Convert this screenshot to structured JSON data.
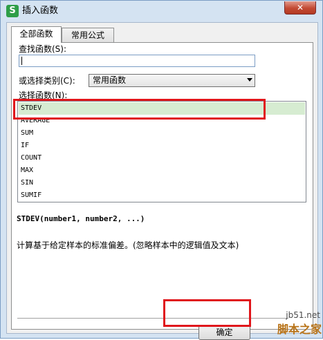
{
  "window": {
    "title": "插入函数",
    "app_icon_letter": "S",
    "close_label": "✕"
  },
  "tabs": [
    {
      "label": "全部函数",
      "active": true
    },
    {
      "label": "常用公式",
      "active": false
    }
  ],
  "search": {
    "label": "查找函数(S):",
    "value": ""
  },
  "category": {
    "label": "或选择类别(C):",
    "selected": "常用函数"
  },
  "function_list": {
    "label": "选择函数(N):",
    "items": [
      "STDEV",
      "AVERAGE",
      "SUM",
      "IF",
      "COUNT",
      "MAX",
      "SIN",
      "SUMIF"
    ],
    "selected": "STDEV"
  },
  "signature": "STDEV(number1, number2, ...)",
  "description": "计算基于给定样本的标准偏差。(忽略样本中的逻辑值及文本)",
  "ok_label": "确定",
  "watermark": {
    "line1": "jb51.net",
    "line2": "脚本之家"
  },
  "colors": {
    "highlight": "#e0161b",
    "selection": "#d6ecd1",
    "frame": "#d4e3f2"
  }
}
